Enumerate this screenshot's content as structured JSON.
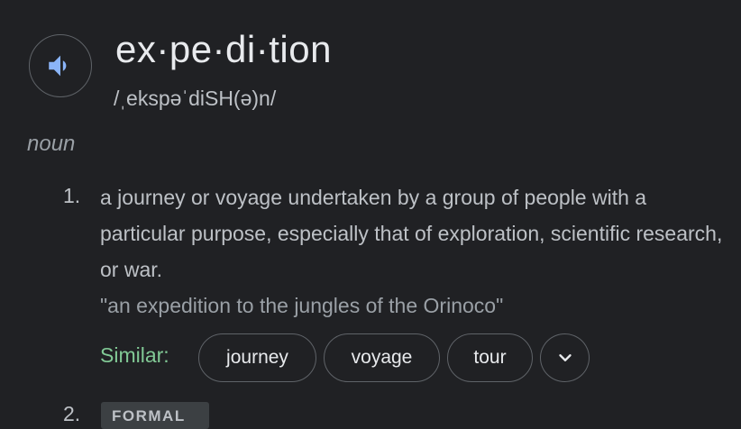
{
  "entry": {
    "word": "ex·pe·di·tion",
    "phonetic": "/ˌekspəˈdiSH(ə)n/",
    "part_of_speech": "noun"
  },
  "definitions": [
    {
      "number": "1.",
      "text": "a journey or voyage undertaken by a group of people with a particular purpose, especially that of exploration, scientific research, or war.",
      "example": "\"an expedition to the jungles of the Orinoco\"",
      "similar_label": "Similar:",
      "similar": [
        "journey",
        "voyage",
        "tour"
      ]
    },
    {
      "number": "2.",
      "badge": "FORMAL"
    }
  ],
  "icons": {
    "speaker": "speaker-icon",
    "expand": "chevron-down-icon"
  },
  "colors": {
    "background": "#202124",
    "icon_accent": "#8ab4f8",
    "similar_label": "#81c995",
    "chip_border": "#5f6368"
  }
}
